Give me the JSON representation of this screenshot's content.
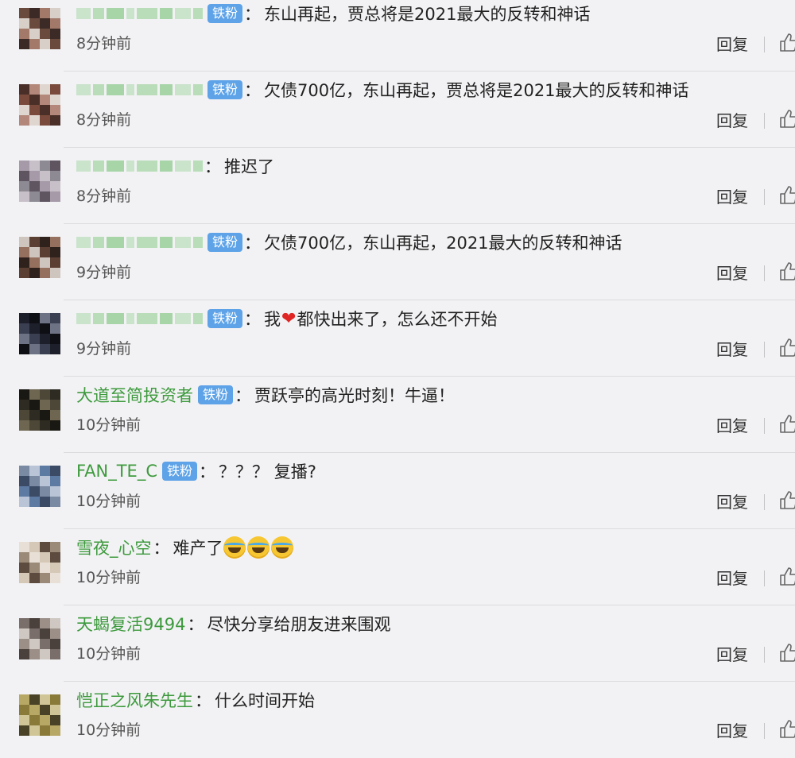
{
  "comments": [
    {
      "user": "",
      "blurred": true,
      "badge": "铁粉",
      "text": "东山再起，贾总将是2021最大的反转和神话",
      "time": "8分钟前",
      "reply": "回复"
    },
    {
      "user": "",
      "blurred": true,
      "badge": "铁粉",
      "text": "欠债700亿，东山再起，贾总将是2021最大的反转和神话",
      "time": "8分钟前",
      "reply": "回复"
    },
    {
      "user": "",
      "blurred": true,
      "badge": "",
      "text": "推迟了",
      "time": "8分钟前",
      "reply": "回复"
    },
    {
      "user": "",
      "blurred": true,
      "badge": "铁粉",
      "text": "欠债700亿，东山再起，2021最大的反转和神话",
      "time": "9分钟前",
      "reply": "回复"
    },
    {
      "user": "",
      "blurred": true,
      "badge": "铁粉",
      "text_before": "我",
      "emoji": "heart",
      "text_after": "都快出来了，怎么还不开始",
      "time": "9分钟前",
      "reply": "回复"
    },
    {
      "user": "大道至简投资者",
      "blurred": false,
      "badge": "铁粉",
      "text": "贾跃亭的高光时刻！牛逼！",
      "time": "10分钟前",
      "reply": "回复"
    },
    {
      "user": "FAN_TE_C",
      "blurred": false,
      "badge": "铁粉",
      "text": "？？？ 复播?",
      "time": "10分钟前",
      "reply": "回复"
    },
    {
      "user": "雪夜_心空",
      "blurred": false,
      "badge": "",
      "text_before": "难产了",
      "emoji": "laugh-cry",
      "emoji_count": 3,
      "text_after": "",
      "time": "10分钟前",
      "reply": "回复"
    },
    {
      "user": "天蝎复活9494",
      "blurred": false,
      "badge": "",
      "text": "尽快分享给朋友进来围观",
      "time": "10分钟前",
      "reply": "回复"
    },
    {
      "user": "恺正之风朱先生",
      "blurred": false,
      "badge": "",
      "text": "什么时间开始",
      "time": "10分钟前",
      "reply": "回复"
    }
  ],
  "colors": {
    "background": "#f2f2f4",
    "username": "#3d9a3d",
    "badge": "#5ea3e8",
    "text": "#222222",
    "time": "#555555"
  },
  "icons": {
    "like": "thumbs-up-icon",
    "heart": "heart-emoji",
    "laugh": "laugh-cry-emoji"
  }
}
